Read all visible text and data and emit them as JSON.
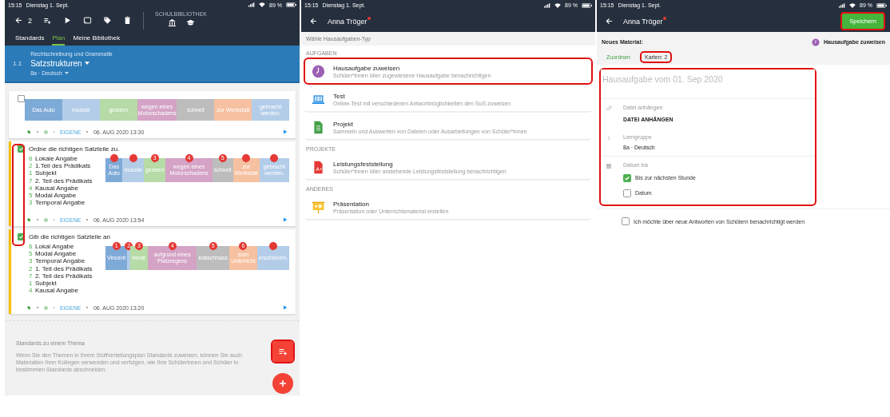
{
  "plan_screen": {
    "status_bar": {
      "time": "15:15",
      "date": "Dienstag 1. Sept.",
      "battery": "89 %"
    },
    "toolbar": {
      "count": "2",
      "library_label": "SCHULBIBLIOTHEK"
    },
    "tabs": [
      {
        "label": "Standards",
        "selected": false
      },
      {
        "label": "Plan",
        "selected": true
      },
      {
        "label": "Meine Bibliothek",
        "selected": false
      }
    ],
    "topic": {
      "number": "1.1",
      "subject": "Rechtschreibung und Grammatik",
      "title": "Satzstrukturen",
      "group": "8a · Deutsch"
    },
    "checkbox_highlight": true,
    "cards": [
      {
        "checked": false,
        "chips": [
          {
            "label": "Das Auto",
            "color": "#7eaad8",
            "pinned": false
          },
          {
            "label": "musste",
            "color": "#b3cde9",
            "pinned": false
          },
          {
            "label": "gestern",
            "color": "#b6dba6",
            "pinned": false
          },
          {
            "label": "wegen eines Motorschadens",
            "color": "#d4a3c5",
            "pinned": false
          },
          {
            "label": "schnell",
            "color": "#bdbdbd",
            "pinned": false
          },
          {
            "label": "zur Werkstatt",
            "color": "#f6c1a1",
            "pinned": false
          },
          {
            "label": "gebracht werden.",
            "color": "#b3cde9",
            "pinned": false
          }
        ],
        "source": "EIGENE",
        "date": "06. AUG 2020 13:30"
      },
      {
        "checked": true,
        "title": "Ordne die richtigen Satzteile zu.",
        "items": [
          {
            "number": "6",
            "label": "Lokale Angabe"
          },
          {
            "number": "2",
            "label": "1.Teil des Prädikats"
          },
          {
            "number": "1",
            "label": "Subjekt"
          },
          {
            "number": "7",
            "label": "2. Teil des Prädikats"
          },
          {
            "number": "4",
            "label": "Kausal Angabe"
          },
          {
            "number": "5",
            "label": "Modal Angabe"
          },
          {
            "number": "3",
            "label": "Temporal Angabe"
          }
        ],
        "chips": [
          {
            "label": "Das Auto",
            "color": "#7eaad8",
            "pinned": true
          },
          {
            "label": "musste",
            "color": "#b3cde9",
            "pinned": true
          },
          {
            "label": "gestern",
            "color": "#b6dba6",
            "pinned": true,
            "pin_number": "3"
          },
          {
            "label": "wegen eines Motorschadens",
            "color": "#d4a3c5",
            "pinned": true,
            "pin_number": "4"
          },
          {
            "label": "schnell",
            "color": "#bdbdbd",
            "pinned": true,
            "pin_number": "5"
          },
          {
            "label": "zur Werkstatt",
            "color": "#f6c1a1",
            "pinned": true
          },
          {
            "label": "gebracht werden.",
            "color": "#b3cde9",
            "pinned": true
          }
        ],
        "source": "EIGENE",
        "date": "06. AUG 2020 13:54"
      },
      {
        "checked": true,
        "title": "Gib die richtigen Satzteile an",
        "items": [
          {
            "number": "6",
            "label": "Lokal Angabe"
          },
          {
            "number": "5",
            "label": "Modal Angabe"
          },
          {
            "number": "3",
            "label": "Temporal Angabe"
          },
          {
            "number": "2",
            "label": "1. Teil des Prädikats"
          },
          {
            "number": "7",
            "label": "2. Teil des Prädikats"
          },
          {
            "number": "1",
            "label": "Subjekt"
          },
          {
            "number": "4",
            "label": "Kausal Angabe"
          }
        ],
        "chips": [
          {
            "label": "Vincent",
            "color": "#7eaad8",
            "pinned": true,
            "pin_number": "1"
          },
          {
            "color": "#b3cde9",
            "pinned": true,
            "pin_number": "2"
          },
          {
            "label": "heute",
            "color": "#b6dba6",
            "pinned": true,
            "pin_number": "3"
          },
          {
            "label": "aufgrund eines Platzregens",
            "color": "#d4a3c5",
            "pinned": true,
            "pin_number": "4"
          },
          {
            "label": "klatschnass",
            "color": "#bdbdbd",
            "pinned": true,
            "pin_number": "5"
          },
          {
            "label": "zum Unterricht",
            "color": "#f6c1a1",
            "pinned": true,
            "pin_number": "6"
          },
          {
            "label": "erschienen.",
            "color": "#b3cde9",
            "pinned": true
          }
        ],
        "source": "EIGENE",
        "date": "06. AUG 2020 13:20"
      }
    ],
    "info": {
      "title": "Standards zu einem Thema",
      "text": "Wenn Sie den Themen in Ihrem Stoffverteilungsplan Standards zuweisen, können Sie auch Materialien Ihrer Kollegen verwenden und verfolgen, wie Ihre Schülerinnen und Schüler in bestimmten Standards abschneiden."
    },
    "fabs": [
      {
        "kind": "add-standard",
        "highlighted": true
      },
      {
        "kind": "add",
        "highlighted": false
      }
    ]
  },
  "type_screen": {
    "status_bar": {
      "time": "15:15",
      "date": "Dienstag 1. Sept.",
      "battery": "89 %"
    },
    "header": {
      "user": "Anna Tröger",
      "unread": true
    },
    "prompt": "Wähle Hausaufgaben-Typ",
    "sections": [
      {
        "heading": "AUFGABEN",
        "items": [
          {
            "kind": "homework",
            "title": "Hausaufgabe zuweisen",
            "subtitle": "Schüler*innen über zugewiesene Hausaufgabe benachrichtigen",
            "highlighted": true
          },
          {
            "kind": "test",
            "title": "Test",
            "subtitle": "Online-Test mit verschiedenen Antwortmöglichkeiten den SuS zuweisen",
            "highlighted": false
          },
          {
            "kind": "project",
            "title": "Projekt",
            "subtitle": "Sammeln und Auswerten von Dateien oder Ausarbeitungen von Schüler*innen",
            "highlighted": false
          }
        ]
      },
      {
        "heading": "PROJEKTE",
        "items": [
          {
            "kind": "assessment",
            "title": "Leistungsfeststellung",
            "subtitle": "Schüler*innen über anstehende Leistungsfeststellung benachrichtigen",
            "highlighted": false
          }
        ]
      },
      {
        "heading": "ANDERES",
        "items": [
          {
            "kind": "presentation",
            "title": "Präsentation",
            "subtitle": "Präsentation oder Unterrichtsmaterial erstellen",
            "highlighted": false
          }
        ]
      }
    ]
  },
  "material_screen": {
    "status_bar": {
      "time": "15:15",
      "date": "Dienstag 1. Sept.",
      "battery": "89 %"
    },
    "header": {
      "user": "Anna Tröger",
      "unread": true,
      "save_label": "Speichern",
      "save_highlighted": true
    },
    "new_material_label": "Neues Material:",
    "type_label": "Hausaufgabe zuweisen",
    "tabs": [
      {
        "label": "Zuordnen",
        "selected": true,
        "highlighted": false
      },
      {
        "label": "Karten: 2",
        "selected": false,
        "highlighted": true
      }
    ],
    "form": {
      "highlighted": true,
      "title_placeholder": "Hausaufgabe vom 01. Sep 2020",
      "attach_label": "Datei anhängen",
      "attach_button": "DATEI ANHÄNGEN",
      "group_label": "Lerngruppe",
      "group_value": "8a · Deutsch",
      "due_label": "Datum bis",
      "due_options": [
        {
          "label": "Bis zur nächsten Stunde",
          "checked": true
        },
        {
          "label": "Datum",
          "checked": false
        }
      ]
    },
    "notify": {
      "label": "Ich möchte über neue Antworten von Schülern benachrichtigt werden",
      "checked": false
    }
  }
}
